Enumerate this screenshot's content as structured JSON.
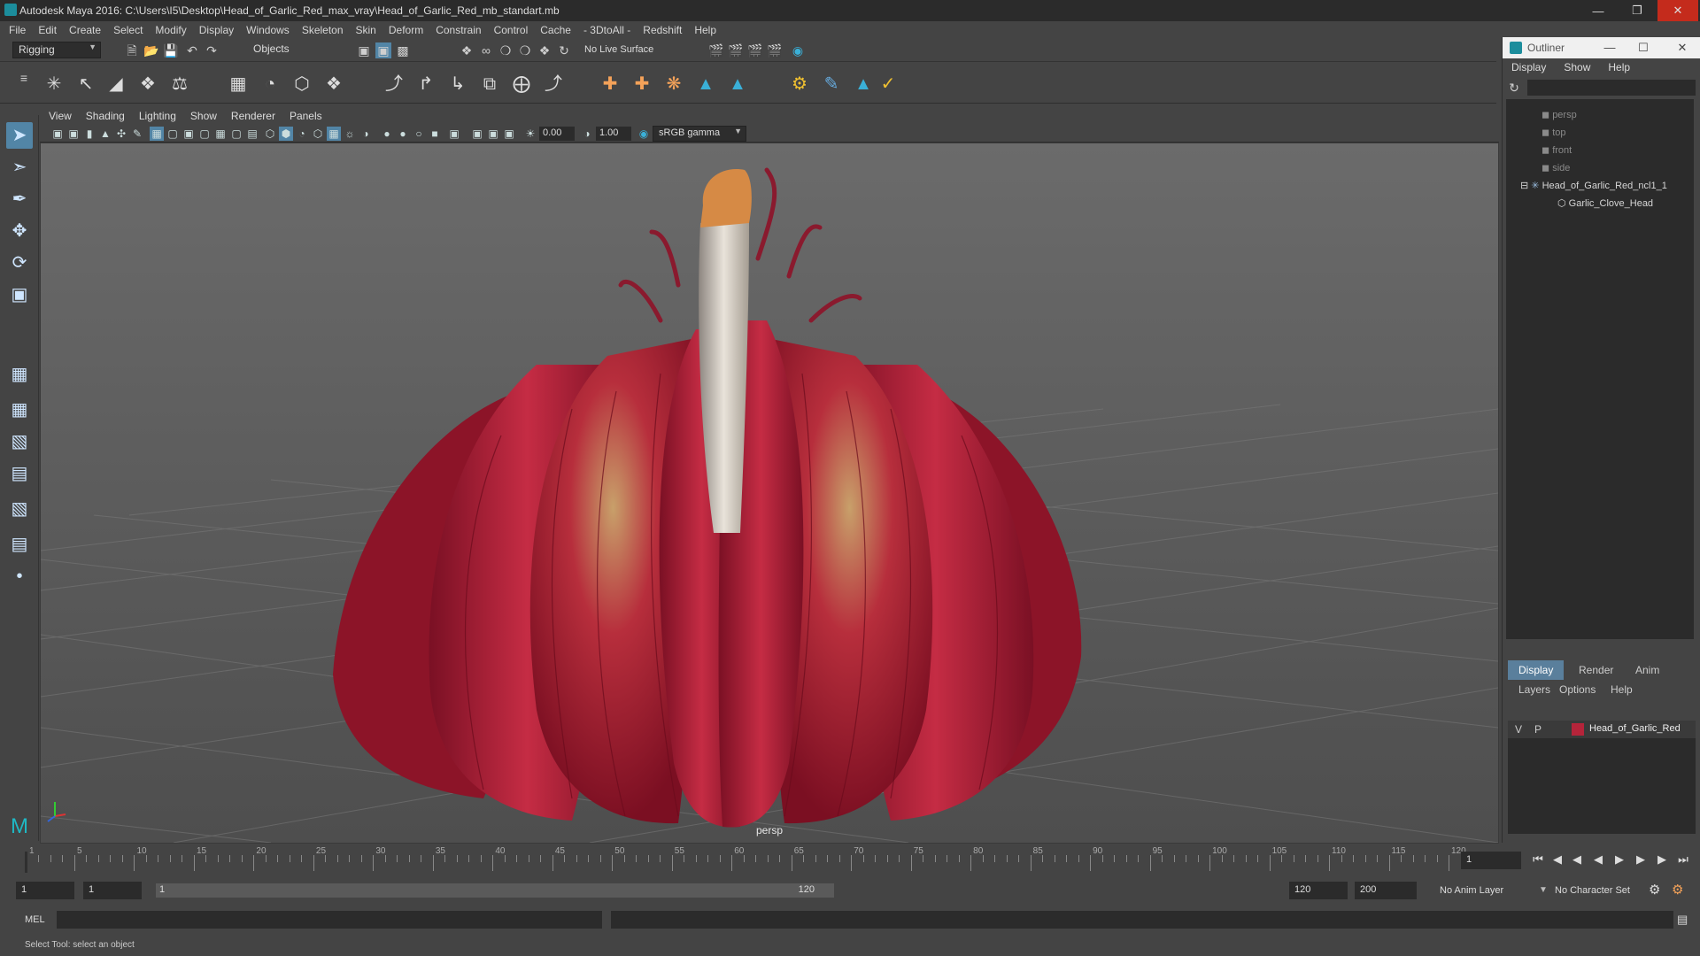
{
  "window": {
    "title": "Autodesk Maya 2016: C:\\Users\\I5\\Desktop\\Head_of_Garlic_Red_max_vray\\Head_of_Garlic_Red_mb_standart.mb"
  },
  "menubar": [
    "File",
    "Edit",
    "Create",
    "Select",
    "Modify",
    "Display",
    "Windows",
    "Skeleton",
    "Skin",
    "Deform",
    "Constrain",
    "Control",
    "Cache",
    "- 3DtoAll -",
    "Redshift",
    "Help"
  ],
  "statusline": {
    "mode": "Rigging",
    "selection_mask": "Objects",
    "live_surface": "No Live Surface"
  },
  "panel": {
    "menu": [
      "View",
      "Shading",
      "Lighting",
      "Show",
      "Renderer",
      "Panels"
    ],
    "exposure": "0.00",
    "gamma": "1.00",
    "color_space": "sRGB gamma",
    "camera_label": "persp"
  },
  "outliner": {
    "title": "Outliner",
    "menu": [
      "Display",
      "Show",
      "Help"
    ],
    "items": [
      {
        "label": "persp",
        "kind": "camera"
      },
      {
        "label": "top",
        "kind": "camera"
      },
      {
        "label": "front",
        "kind": "camera"
      },
      {
        "label": "side",
        "kind": "camera"
      },
      {
        "label": "Head_of_Garlic_Red_ncl1_1",
        "kind": "group"
      },
      {
        "label": "Garlic_Clove_Head",
        "kind": "mesh"
      }
    ]
  },
  "layers": {
    "tabs": [
      "Display",
      "Render",
      "Anim"
    ],
    "menu": [
      "Layers",
      "Options",
      "Help"
    ],
    "rows": [
      {
        "v": "V",
        "p": "P",
        "name": "Head_of_Garlic_Red",
        "color": "#b5243a"
      }
    ]
  },
  "timeline": {
    "ticks": [
      1,
      5,
      10,
      15,
      20,
      25,
      30,
      35,
      40,
      45,
      50,
      55,
      60,
      65,
      70,
      75,
      80,
      85,
      90,
      95,
      100,
      105,
      110,
      115,
      120
    ],
    "current_frame": "1",
    "range_start": "1",
    "range_inner_start": "1",
    "range_slider_start": "1",
    "range_slider_end": "120",
    "range_end": "120",
    "anim_end": "200",
    "anim_layer": "No Anim Layer",
    "character_set": "No Character Set"
  },
  "command_line": {
    "language": "MEL"
  },
  "help_line": "Select Tool: select an object",
  "colors": {
    "accent": "#5285a6",
    "garlic": "#b01c34"
  }
}
